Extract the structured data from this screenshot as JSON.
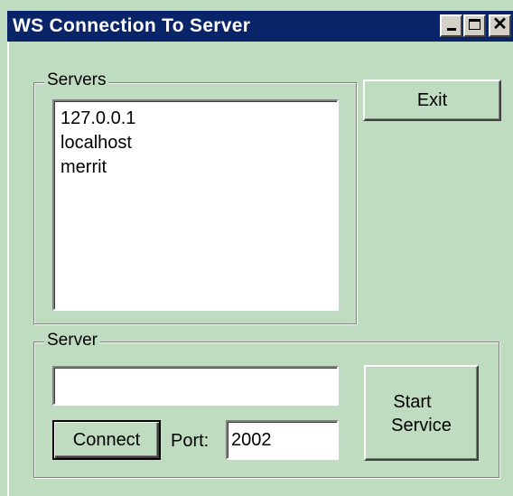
{
  "window": {
    "title": "WS Connection To Server",
    "controls": {
      "minimize_icon": "minimize-icon",
      "maximize_icon": "maximize-icon",
      "close_icon": "close-icon",
      "close_glyph": "✕"
    }
  },
  "servers_group": {
    "legend": "Servers",
    "items": [
      "127.0.0.1",
      "localhost",
      "merrit"
    ]
  },
  "exit_button": {
    "label": "Exit"
  },
  "server_group": {
    "legend": "Server",
    "server_input": {
      "value": "",
      "placeholder": ""
    },
    "connect_label": "Connect",
    "port_label": "Port:",
    "port_input": {
      "value": "2002"
    },
    "start_service_line1": "Start",
    "start_service_line2": "Service"
  },
  "colors": {
    "background": "#c0dcc0",
    "titlebar": "#0a246a",
    "title_text": "#ffffff"
  }
}
